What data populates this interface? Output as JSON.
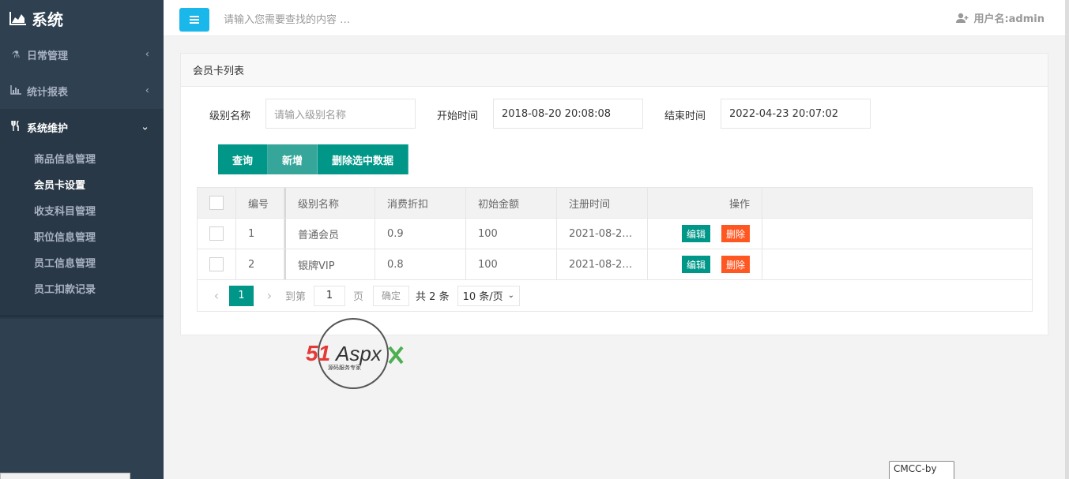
{
  "app": {
    "title": "系统"
  },
  "sidebar": {
    "items": [
      {
        "label": "日常管理",
        "icon": "flask-icon"
      },
      {
        "label": "统计报表",
        "icon": "bar-chart-icon"
      },
      {
        "label": "系统维护",
        "icon": "cutlery-icon"
      }
    ],
    "sub_items": [
      "商品信息管理",
      "会员卡设置",
      "收支科目管理",
      "职位信息管理",
      "员工信息管理",
      "员工扣款记录"
    ],
    "active_sub": "会员卡设置"
  },
  "header": {
    "search_placeholder": "请输入您需要查找的内容 …",
    "user_label": "用户名:admin"
  },
  "panel": {
    "title": "会员卡列表",
    "filters": {
      "level_label": "级别名称",
      "level_placeholder": "请输入级别名称",
      "start_label": "开始时间",
      "start_value": "2018-08-20 20:08:08",
      "end_label": "结束时间",
      "end_value": "2022-04-23 20:07:02"
    },
    "buttons": {
      "query": "查询",
      "add": "新增",
      "delete_selected": "删除选中数据"
    }
  },
  "table": {
    "headers": [
      "编号",
      "级别名称",
      "消费折扣",
      "初始金额",
      "注册时间",
      "操作"
    ],
    "rows": [
      {
        "id": "1",
        "name": "普通会员",
        "discount": "0.9",
        "amount": "100",
        "time": "2021-08-2…"
      },
      {
        "id": "2",
        "name": "银牌VIP",
        "discount": "0.8",
        "amount": "100",
        "time": "2021-08-2…"
      }
    ],
    "edit_label": "编辑",
    "delete_label": "删除"
  },
  "pager": {
    "current": "1",
    "goto_label": "到第",
    "goto_value": "1",
    "page_unit": "页",
    "confirm": "确定",
    "total": "共 2 条",
    "page_size": "10 条/页"
  },
  "watermark": {
    "brand": "51Aspx",
    "slogan": "源码服务专家"
  },
  "tooltip": {
    "text": "CMCC-by"
  },
  "colors": {
    "sidebar": "#2f4050",
    "accent": "#009688",
    "danger": "#ff5722",
    "menu_button": "#1ab7ea"
  }
}
